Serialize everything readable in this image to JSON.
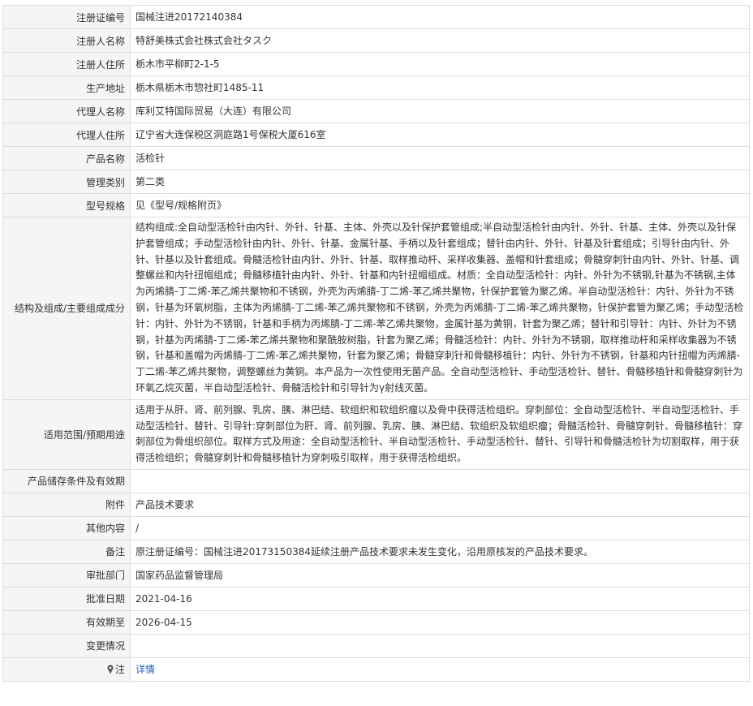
{
  "rows": [
    {
      "label": "注册证编号",
      "value": "国械注进20172140384"
    },
    {
      "label": "注册人名称",
      "value": "特舒美株式会社株式会社タスク"
    },
    {
      "label": "注册人住所",
      "value": "栃木市平柳町2-1-5"
    },
    {
      "label": "生产地址",
      "value": "栃木県栃木市惣社町1485-11"
    },
    {
      "label": "代理人名称",
      "value": "库利艾特国际贸易（大连）有限公司"
    },
    {
      "label": "代理人住所",
      "value": "辽宁省大连保税区洞庭路1号保税大厦616室"
    },
    {
      "label": "产品名称",
      "value": "活检针"
    },
    {
      "label": "管理类别",
      "value": "第二类"
    },
    {
      "label": "型号规格",
      "value": "见《型号/规格附页》"
    },
    {
      "label": "结构及组成/主要组成成分",
      "value": "结构组成:全自动型活检针由内针、外针、针基、主体、外壳以及针保护套管组成;半自动型活检针由内针、外针、针基、主体、外壳以及针保护套管组成；手动型活检针由内针、外针、针基、金属针基、手柄以及针套组成；替针由内针、外针、针基及针套组成；引导针由内针、外针、针基以及针套组成。骨髓活检针由内针、外针、针基、取样推动杆、采样收集器、盖帽和针套组成；骨髓穿刺针由内针、外针、针基、调整螺丝和内针扭帽组成；骨髓移植针由内针、外针、针基和内针扭帽组成。材质：全自动型活检针：内针、外针为不锈钢,针基为不锈钢,主体为丙烯腈-丁二烯-苯乙烯共聚物和不锈钢，外壳为丙烯腈-丁二烯-苯乙烯共聚物，针保护套管为聚乙烯。半自动型活检针：内针、外针为不锈钢，针基为环氧树脂，主体为丙烯腈-丁二烯-苯乙烯共聚物和不锈钢，外壳为丙烯腈-丁二烯-苯乙烯共聚物，针保护套管为聚乙烯；手动型活检针：内针、外针为不锈钢，针基和手柄为丙烯腈-丁二烯-苯乙烯共聚物，金属针基为黄铜，针套为聚乙烯；替针和引导针：内针、外针为不锈钢，针基为丙烯腈-丁二烯-苯乙烯共聚物和聚酰胺树脂，针套为聚乙烯；骨髓活检针：内针、外针为不锈钢，取样推动杆和采样收集器为不锈钢，针基和盖帽为丙烯腈-丁二烯-苯乙烯共聚物，针套为聚乙烯；骨髓穿刺针和骨髓移植针：内针、外针为不锈钢，针基和内针扭帽为丙烯腈-丁二烯-苯乙烯共聚物，调整螺丝为黄铜。本产品为一次性使用无菌产品。全自动型活检针、手动型活检针、替针、骨髓移植针和骨髓穿刺针为环氧乙烷灭菌，半自动型活检针、骨髓活检针和引导针为γ射线灭菌。"
    },
    {
      "label": "适用范围/预期用途",
      "value": "适用于从肝、肾、前列腺、乳房、胰、淋巴结、软组织和软组织瘤以及骨中获得活检组织。穿刺部位：全自动型活检针、半自动型活检针、手动型活检针、替针、引导针:穿刺部位为肝、肾、前列腺、乳房、胰、淋巴结、软组织及软组织瘤；骨髓活检针、骨髓穿刺针、骨髓移植针：穿刺部位为骨组织部位。取样方式及用途：全自动型活检针、半自动型活检针、手动型活检针、替针、引导针和骨髓活检针为切割取样，用于获得活检组织；骨髓穿刺针和骨髓移植针为穿刺吸引取样，用于获得活检组织。"
    },
    {
      "label": "产品储存条件及有效期",
      "value": ""
    },
    {
      "label": "附件",
      "value": "产品技术要求"
    },
    {
      "label": "其他内容",
      "value": "/"
    },
    {
      "label": "备注",
      "value": "原注册证编号：国械注进20173150384延续注册产品技术要求未发生变化，沿用原核发的产品技术要求。"
    },
    {
      "label": "审批部门",
      "value": "国家药品监督管理局"
    },
    {
      "label": "批准日期",
      "value": "2021-04-16"
    },
    {
      "label": "有效期至",
      "value": "2026-04-15"
    },
    {
      "label": "变更情况",
      "value": ""
    }
  ],
  "note_row": {
    "label": "注",
    "icon": "pin-icon",
    "link_text": "详情",
    "link_color": "#1a62b8"
  },
  "colors": {
    "label_bg": "#f5f5f5",
    "border": "#dddddd",
    "text": "#333333"
  }
}
